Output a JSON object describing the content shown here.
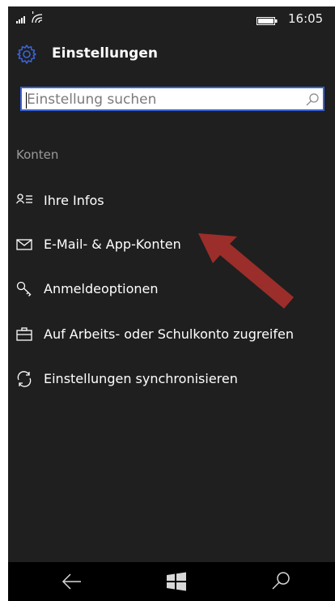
{
  "status": {
    "time": "16:05"
  },
  "header": {
    "title": "Einstellungen"
  },
  "search": {
    "placeholder": "Einstellung suchen"
  },
  "section": {
    "title": "Konten"
  },
  "menu": {
    "items": [
      {
        "label": "Ihre Infos",
        "icon": "person-list-icon"
      },
      {
        "label": "E-Mail- & App-Konten",
        "icon": "mail-icon"
      },
      {
        "label": "Anmeldeoptionen",
        "icon": "key-icon"
      },
      {
        "label": "Auf Arbeits- oder Schulkonto zugreifen",
        "icon": "briefcase-icon"
      },
      {
        "label": "Einstellungen synchronisieren",
        "icon": "sync-icon"
      }
    ]
  },
  "annotation": {
    "arrow_color": "#9b2e2a"
  },
  "nav": {
    "back": "back-arrow-icon",
    "home": "windows-logo-icon",
    "search": "search-icon"
  },
  "colors": {
    "background": "#1f1f1f",
    "accent": "#3a63d9",
    "text": "#ffffff",
    "muted": "#9a9a9a"
  }
}
